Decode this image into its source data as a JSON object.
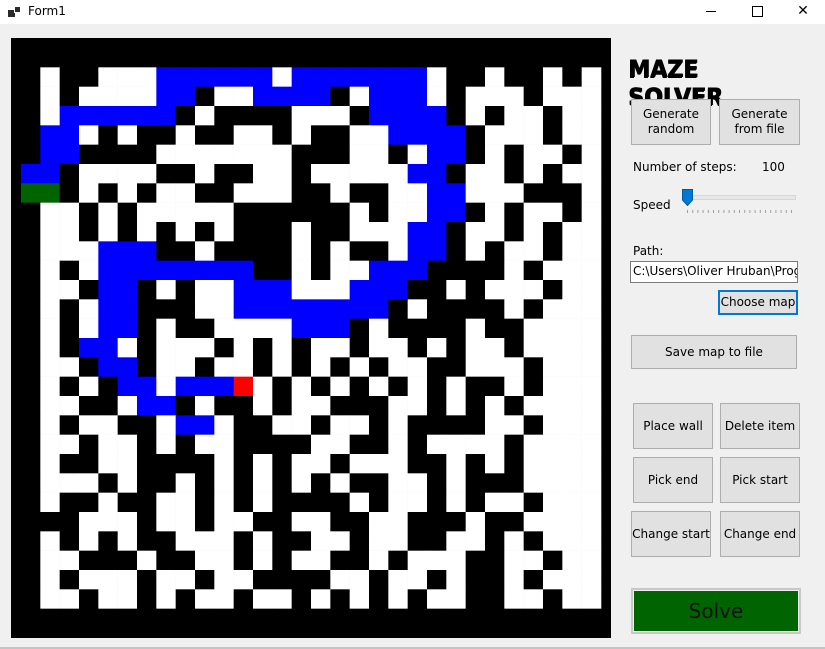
{
  "window": {
    "title": "Form1"
  },
  "app": {
    "heading": "MAZE SOLVER"
  },
  "buttons": {
    "generate_random": "Generate random",
    "generate_from_file": "Generate from file",
    "choose_map": "Choose map",
    "save_map": "Save map to file",
    "place_wall": "Place wall",
    "delete_item": "Delete item",
    "pick_end": "Pick end",
    "pick_start": "Pick start",
    "change_start": "Change start",
    "change_end": "Change end",
    "solve": "Solve"
  },
  "labels": {
    "steps_label": "Number of steps:",
    "steps_value": "100",
    "speed_label": "Speed",
    "path_label": "Path:"
  },
  "path": {
    "value": "C:\\Users\\Oliver Hruban\\Progra"
  },
  "speed": {
    "value": 0
  },
  "colors": {
    "wall": "#000000",
    "floor": "#ffffff",
    "path": "#0000ff",
    "start": "#006400",
    "end": "#ff0000",
    "solve_bg": "#006400"
  },
  "maze": {
    "grid_size": 30,
    "rows": [
      "##############################",
      "#.##...PPPPPP.PPPPPPP.##.##.#.#",
      "#.#....PP#..PPPP#.PPP.#...#...",
      "#.PPPPPP#.####...#PPPP#.#..#.",
      "#PP.#.##.##..#.##..PPPP#...#..",
      "#PP####.......###..#.PP#.#..#.",
      "PP#....##.##..#.....PP#..#.#.",
      "SS#.#.#..##...##.##..PP...###",
      "#..#.#.....######.#..PP#.#..#",
      "#..#.#.#.#.###.##...PP#..#.#.",
      "#...PPP##.####.#.##.PP#.#..#.",
      "#.#.PPPPPPPP##.#..PPP####.#..",
      "#..#PP#.#..PPP...PPP##.#...#.",
      "#.#.PP###..PPPPPPPP#.####.#..",
      "#.#.PP#.##....PPP#.####.##..",
      "#.#PP.#...#.#.#..#..#.#..#...",
      "#..#PP#..#..#.#.#.#..##...#.",
      "#.#.#PP.PPPE.#.#.#.#.#.##.#.",
      "#..##.PP#.##.#..###..#.#.#..",
      "#.#..##.PP.##..#..#.####..#.",
      "#..#..#.#..####..##.#....#..",
      "#.##..####.#.#..#...##.#.#..",
      "#...#.##.#.#.#.#.##..#.###..",
      "#.##.##..#.#.####.#..#.#..#.",
      "###...#..#..##..##..###.##..",
      "#.#.#.##...#.##..#..##..#.#.",
      "#..###.##..#.#..##.#...##..#",
      "#.#...#..#..####..#..#.##.#.",
      "#..#..#.#..#..#.#.#.#..##..#",
      "##############################"
    ]
  }
}
